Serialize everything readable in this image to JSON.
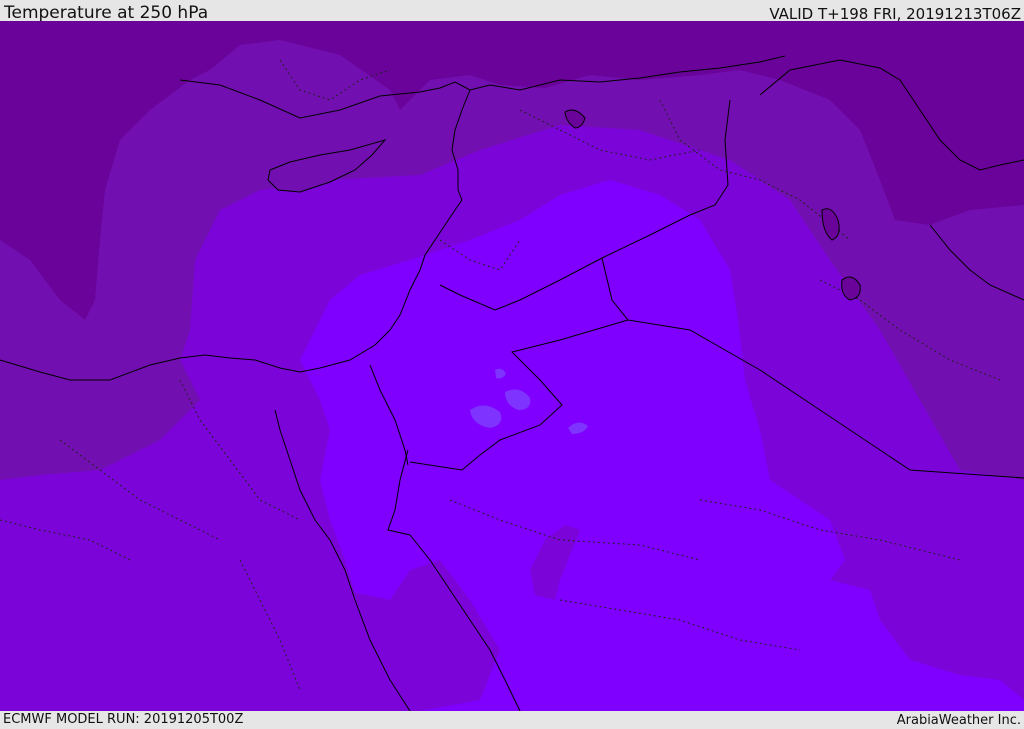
{
  "header": {
    "title": "Temperature at 250 hPa",
    "valid": "VALID T+198 FRI, 20191213T06Z"
  },
  "footer": {
    "model_run": "ECMWF MODEL RUN: 20191205T00Z",
    "credit": "ArabiaWeather Inc."
  },
  "map": {
    "region": "Eastern Mediterranean and Middle East",
    "field": "temperature",
    "level": "250 hPa",
    "colors": {
      "coldest": "#6a0399",
      "cold": "#720fb0",
      "cool": "#7b05d9",
      "mild": "#7e00f0",
      "warm": "#7f00ff",
      "warmest_patch": "#7f33ff",
      "boundary_line": "#000000"
    }
  }
}
